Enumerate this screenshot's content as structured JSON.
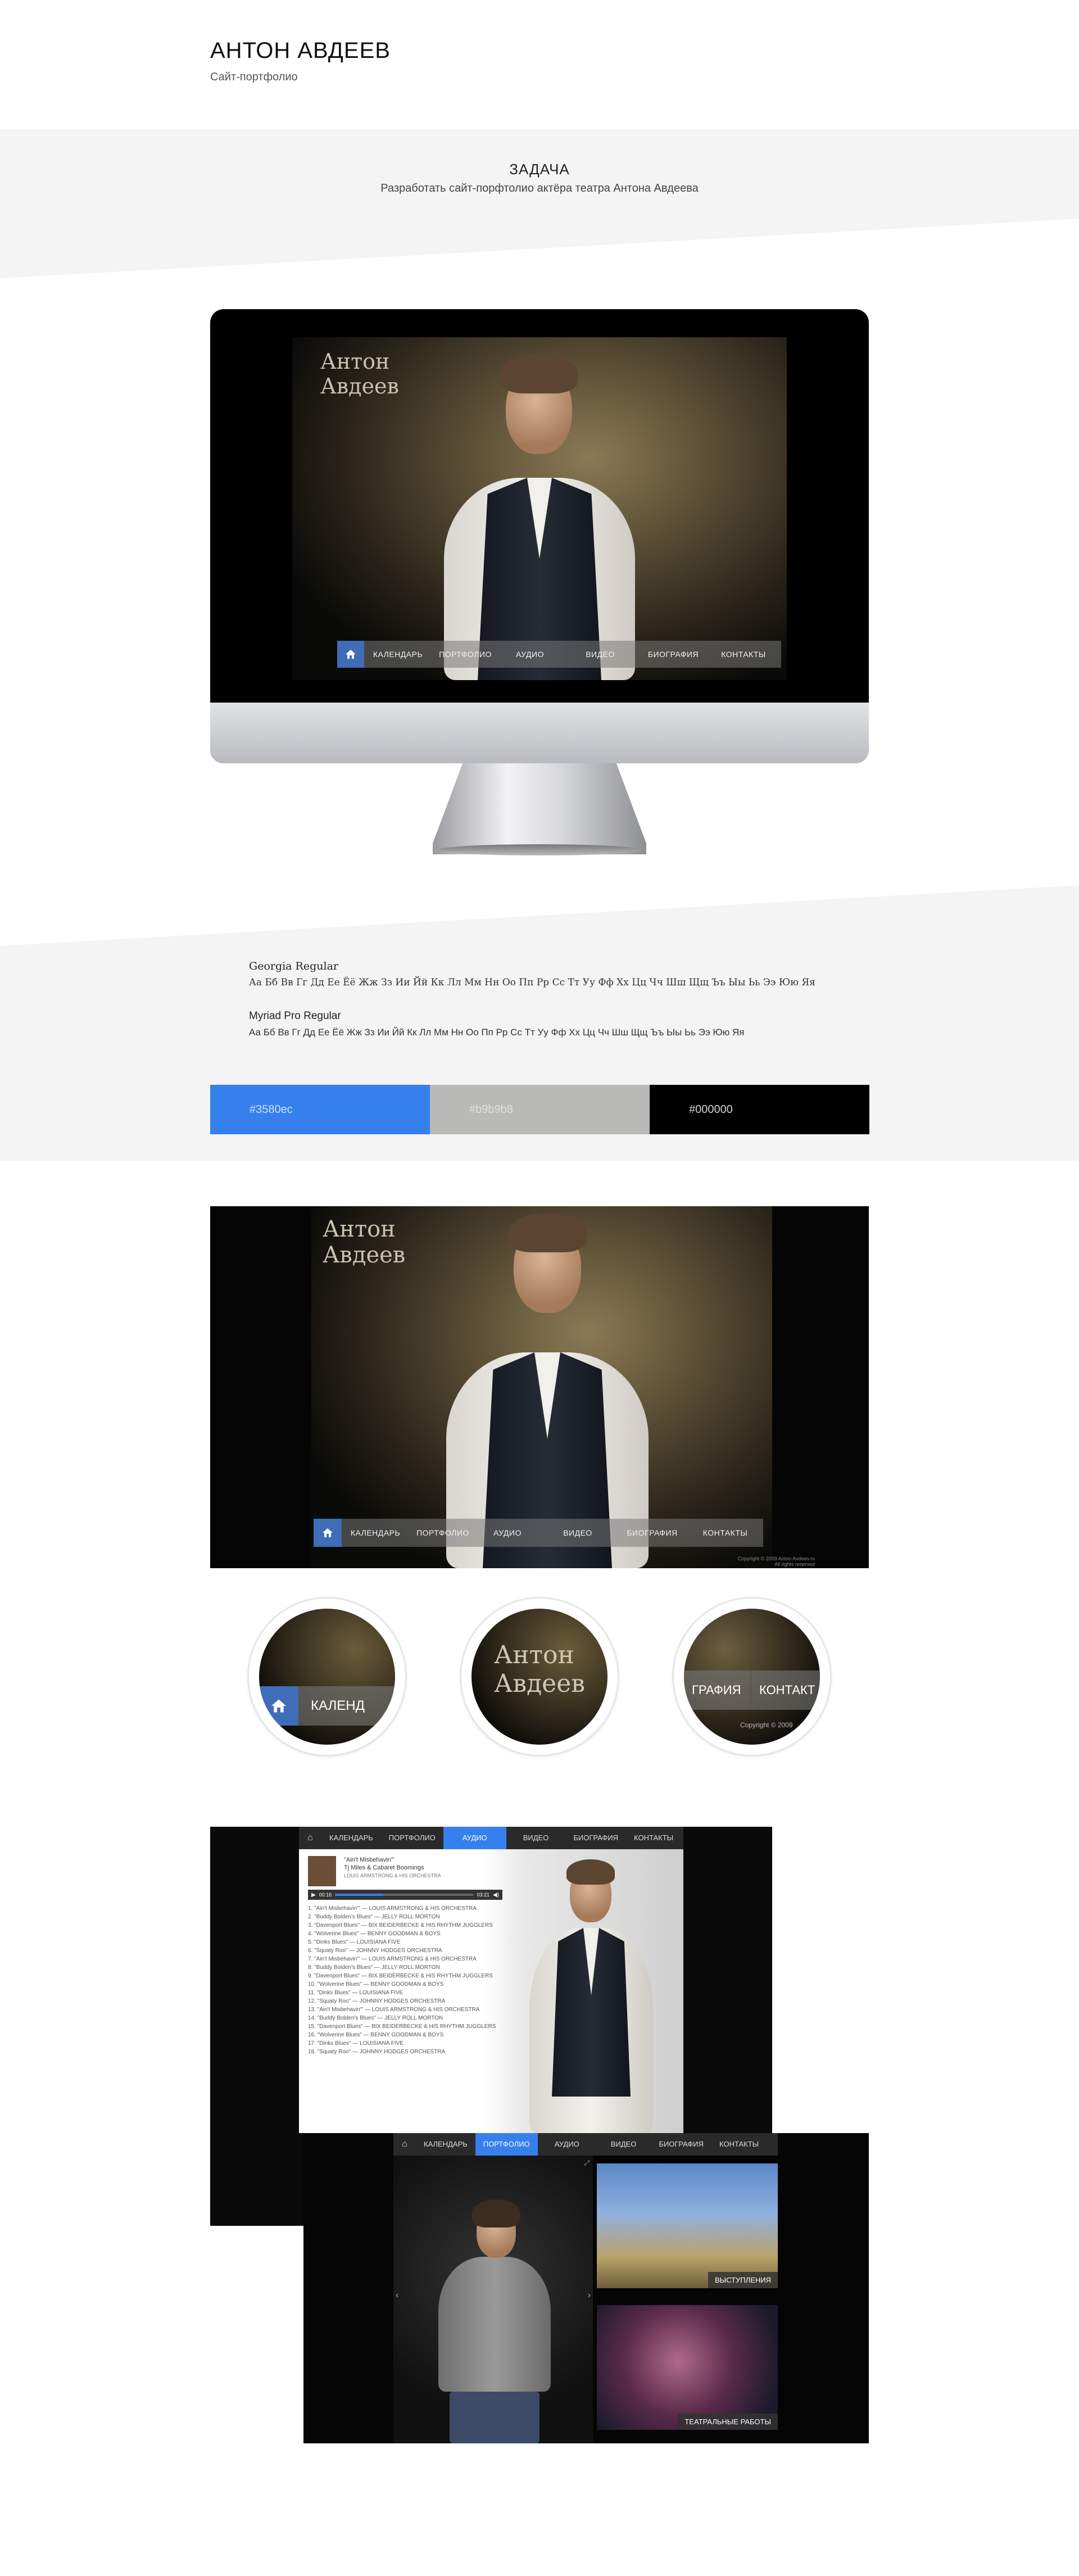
{
  "header": {
    "title": "АНТОН АВДЕЕВ",
    "subtitle": "Сайт-портфолио"
  },
  "task": {
    "title": "ЗАДАЧА",
    "text": "Разработать сайт-порфтолио актёра театра Антона Авдеева"
  },
  "site": {
    "name_line1": "Антон",
    "name_line2": "Авдеев",
    "nav": [
      "КАЛЕНДАРЬ",
      "ПОРТФОЛИО",
      "АУДИО",
      "ВИДЕО",
      "БИОГРАФИЯ",
      "КОНТАКТЫ"
    ],
    "copyright": "Copyright © 2009 Anton Avdeev.ru",
    "rights": "All rights reserved"
  },
  "typography": {
    "font1_name": "Georgia Regular",
    "font1_alphabet": "Аа Бб Вв Гг Дд Ее Ёё Жж Зз Ии Йй Кк Лл Мм Нн Оо Пп Рр Сс Тт Уу Фф Хх Цц Чч Шш Щщ Ъъ Ыы Ьь Ээ Юю Яя",
    "font2_name": "Myriad Pro Regular",
    "font2_alphabet": "Аа Бб Вв Гг Дд Ее Ёё Жж Зз Ии Йй Кк Лл Мм Нн Оо Пп Рр Сс Тт Уу Фф Хх Цц Чч Шш Щщ Ъъ Ыы Ьь Ээ Юю Яя"
  },
  "colors": {
    "blue": "#3580ec",
    "gray": "#b9b9b8",
    "black": "#000000"
  },
  "circles": {
    "c1_text": "КАЛЕНД",
    "c2_line1": "Антон",
    "c2_line2": "Авдеев",
    "c3_a": "ГРАФИЯ",
    "c3_b": "КОНТАКТ",
    "c3_copy": "Copyright © 2009"
  },
  "audio_page": {
    "nav": [
      "КАЛЕНДАРЬ",
      "ПОРТФОЛИО",
      "АУДИО",
      "ВИДЕО",
      "БИОГРАФИЯ",
      "КОНТАКТЫ"
    ],
    "active": "АУДИО",
    "now_playing_title": "\"Ain't Misbehavin'\"",
    "now_playing_sub": "Tj Miles & Cabaret Boomings",
    "now_playing_sub2": "LOUIS ARMSTRONG & HIS ORCHESTRA",
    "time_left": "00:16",
    "time_right": "03:21",
    "tracks": [
      "1. \"Ain't Misbehavin'\" — LOUIS ARMSTRONG & HIS ORCHESTRA",
      "2. \"Buddy Bolden's Blues\" — JELLY ROLL MORTON",
      "3. \"Davenport Blues\" — BIX BEIDERBECKE & HIS RHYTHM JUGGLERS",
      "4. \"Wolverine Blues\" — BENNY GOODMAN & BOYS",
      "5. \"Dinks Blues\" — LOUISIANA FIVE",
      "6. \"Squaty Roo\" — JOHNNY HODGES ORCHESTRA",
      "7. \"Ain't Misbehavin'\" — LOUIS ARMSTRONG & HIS ORCHESTRA",
      "8. \"Buddy Bolden's Blues\" — JELLY ROLL MORTON",
      "9. \"Davenport Blues\" — BIX BEIDERBECKE & HIS RHYTHM JUGGLERS",
      "10. \"Wolverine Blues\" — BENNY GOODMAN & BOYS",
      "11. \"Dinks Blues\" — LOUISIANA FIVE",
      "12. \"Squaty Roo\" — JOHNNY HODGES ORCHESTRA",
      "13. \"Ain't Misbehavin'\" — LOUIS ARMSTRONG & HIS ORCHESTRA",
      "14. \"Buddy Bolden's Blues\" — JELLY ROLL MORTON",
      "15. \"Davenport Blues\" — BIX BEIDERBECKE & HIS RHYTHM JUGGLERS",
      "16. \"Wolverine Blues\" — BENNY GOODMAN & BOYS",
      "17. \"Dinks Blues\" — LOUISIANA FIVE",
      "18. \"Squaty Roo\" — JOHNNY HODGES ORCHESTRA"
    ]
  },
  "portfolio_page": {
    "nav": [
      "КАЛЕНДАРЬ",
      "ПОРТФОЛИО",
      "АУДИО",
      "ВИДЕО",
      "БИОГРАФИЯ",
      "КОНТАКТЫ"
    ],
    "active": "ПОРТФОЛИО",
    "gallery1_caption": "ВЫСТУПЛЕНИЯ",
    "gallery2_caption": "ТЕАТРАЛЬНЫЕ РАБОТЫ"
  }
}
